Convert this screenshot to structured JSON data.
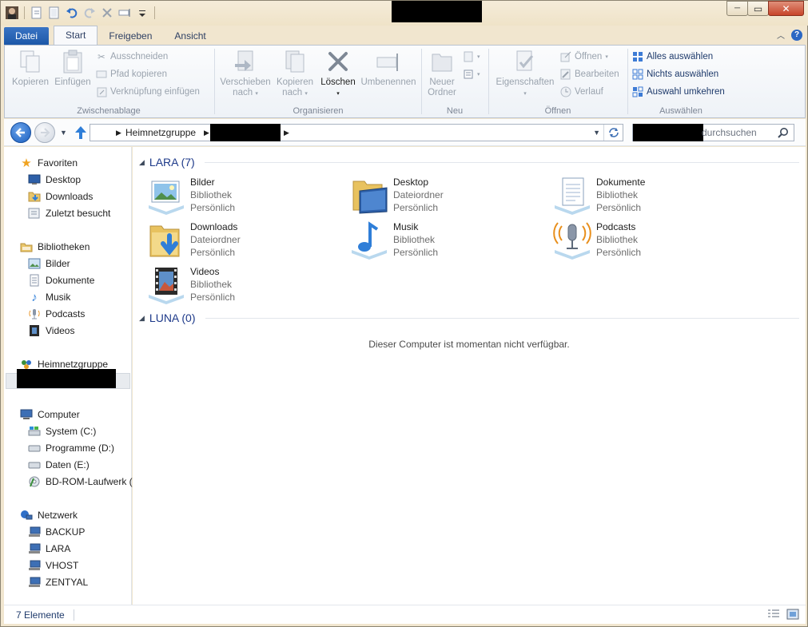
{
  "window": {
    "minimize_glyph": "─",
    "maximize_glyph": "▭",
    "close_glyph": "✕"
  },
  "ribbon_tabs": [
    {
      "label": "Datei"
    },
    {
      "label": "Start"
    },
    {
      "label": "Freigeben"
    },
    {
      "label": "Ansicht"
    }
  ],
  "ribbon": {
    "clipboard": {
      "copy": "Kopieren",
      "paste": "Einfügen",
      "cut": "Ausschneiden",
      "copy_path": "Pfad kopieren",
      "paste_shortcut": "Verknüpfung einfügen",
      "label": "Zwischenablage"
    },
    "organize": {
      "move_to_1": "Verschieben",
      "move_to_2": "nach",
      "copy_to_1": "Kopieren",
      "copy_to_2": "nach",
      "delete": "Löschen",
      "rename": "Umbenennen",
      "label": "Organisieren"
    },
    "new": {
      "new_folder_1": "Neuer",
      "new_folder_2": "Ordner",
      "label": "Neu"
    },
    "open": {
      "properties": "Eigenschaften",
      "open": "Öffnen",
      "edit": "Bearbeiten",
      "history": "Verlauf",
      "label": "Öffnen"
    },
    "select": {
      "select_all": "Alles auswählen",
      "select_none": "Nichts auswählen",
      "invert": "Auswahl umkehren",
      "label": "Auswählen"
    }
  },
  "address": {
    "crumb_homegroup": "Heimnetzgruppe",
    "search_placeholder": "durchsuchen"
  },
  "sidebar": {
    "favorites": {
      "title": "Favoriten",
      "items": [
        "Desktop",
        "Downloads",
        "Zuletzt besucht"
      ]
    },
    "libraries": {
      "title": "Bibliotheken",
      "items": [
        "Bilder",
        "Dokumente",
        "Musik",
        "Podcasts",
        "Videos"
      ]
    },
    "homegroup": {
      "title": "Heimnetzgruppe"
    },
    "computer": {
      "title": "Computer",
      "items": [
        "System (C:)",
        "Programme (D:)",
        "Daten (E:)",
        "BD-ROM-Laufwerk ("
      ]
    },
    "network": {
      "title": "Netzwerk",
      "items": [
        "BACKUP",
        "LARA",
        "VHOST",
        "ZENTYAL"
      ]
    }
  },
  "main": {
    "group1": {
      "title": "LARA (7)"
    },
    "tiles": [
      {
        "name": "Bilder",
        "type": "Bibliothek",
        "owner": "Persönlich"
      },
      {
        "name": "Desktop",
        "type": "Dateiordner",
        "owner": "Persönlich"
      },
      {
        "name": "Dokumente",
        "type": "Bibliothek",
        "owner": "Persönlich"
      },
      {
        "name": "Downloads",
        "type": "Dateiordner",
        "owner": "Persönlich"
      },
      {
        "name": "Musik",
        "type": "Bibliothek",
        "owner": "Persönlich"
      },
      {
        "name": "Podcasts",
        "type": "Bibliothek",
        "owner": "Persönlich"
      },
      {
        "name": "Videos",
        "type": "Bibliothek",
        "owner": "Persönlich"
      }
    ],
    "group2": {
      "title": "LUNA (0)"
    },
    "empty_message": "Dieser Computer ist momentan nicht verfügbar."
  },
  "status": {
    "count": "7 Elemente"
  }
}
